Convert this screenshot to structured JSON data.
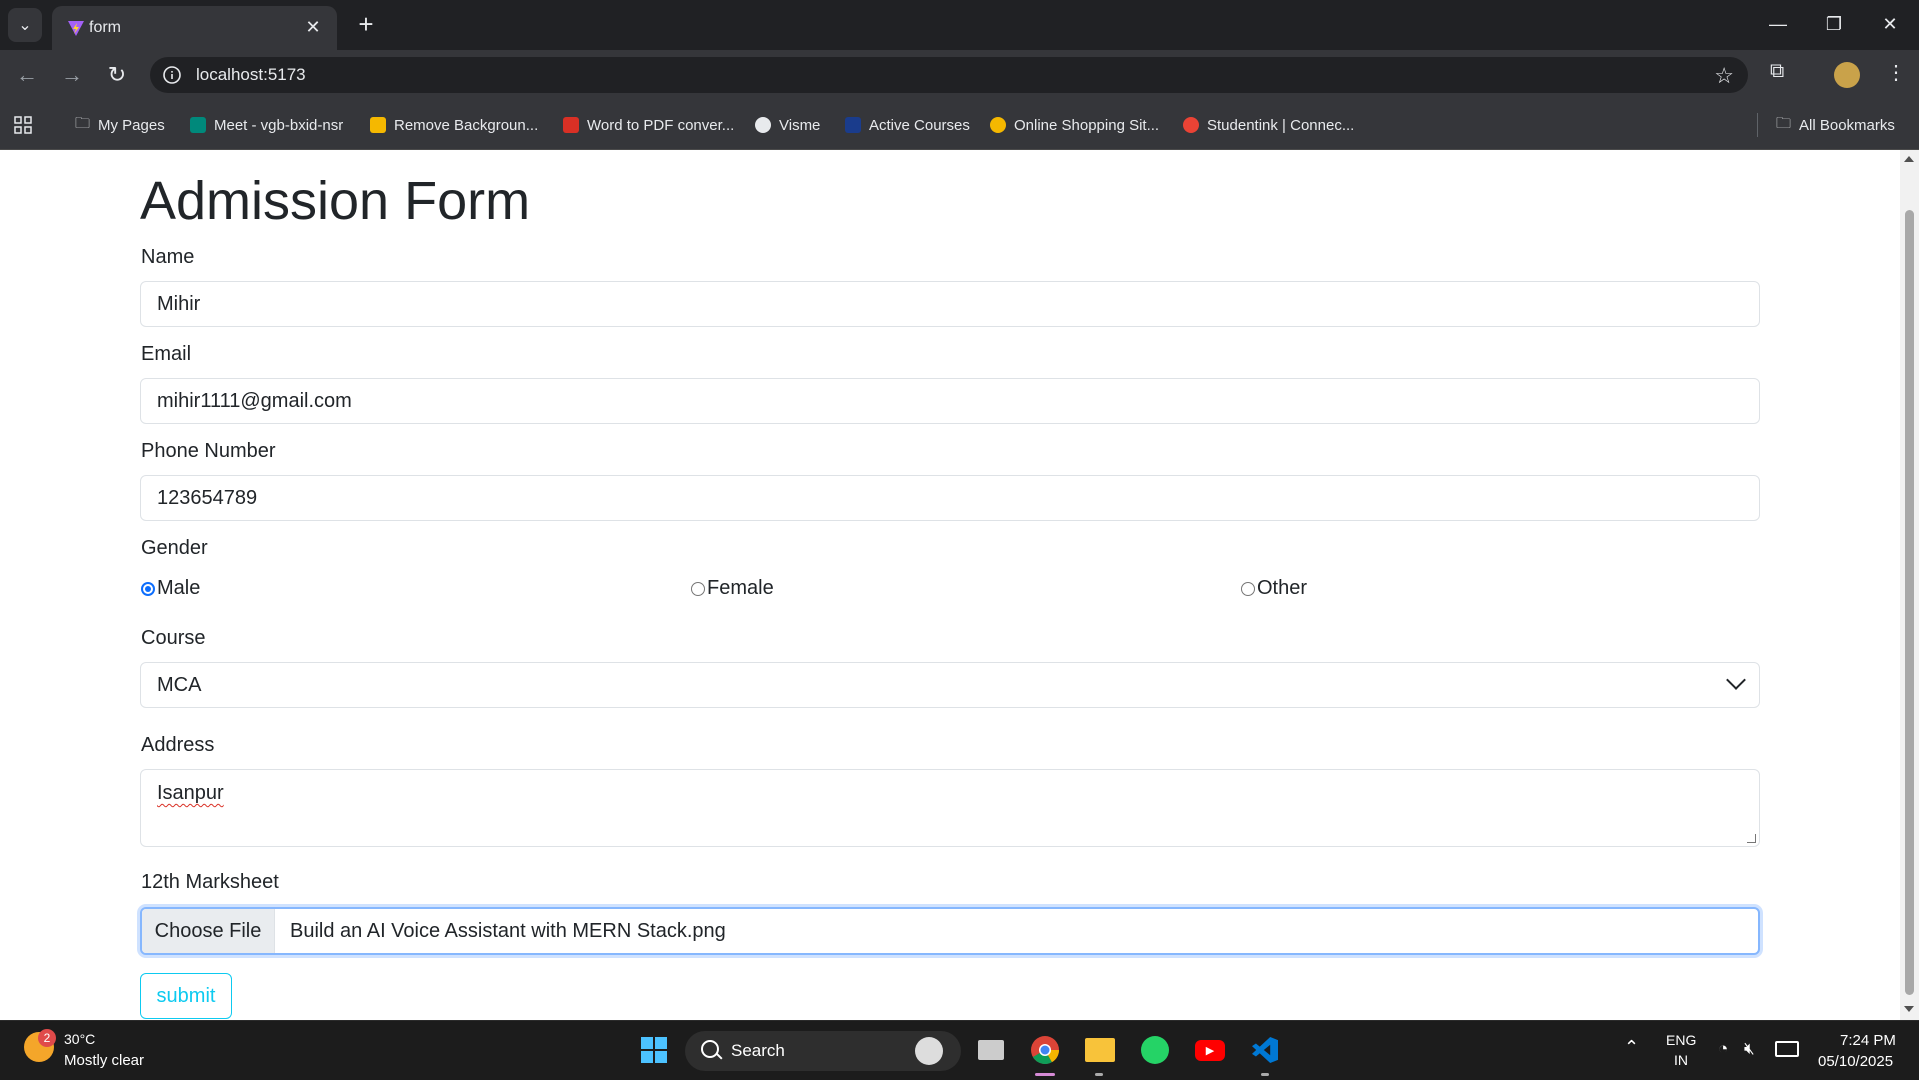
{
  "browser": {
    "tab_title": "form",
    "url": "localhost:5173",
    "bookmarks": [
      "My Pages",
      "Meet - vgb-bxid-nsr",
      "Remove Backgroun...",
      "Word to PDF conver...",
      "Visme",
      "Active Courses",
      "Online Shopping Sit...",
      "Studentink | Connec..."
    ],
    "all_bookmarks": "All Bookmarks"
  },
  "form": {
    "title": "Admission Form",
    "name_label": "Name",
    "name_value": "Mihir",
    "email_label": "Email",
    "email_value": "mihir1111@gmail.com",
    "phone_label": "Phone Number",
    "phone_value": "123654789",
    "gender_label": "Gender",
    "gender_options": [
      "Male",
      "Female",
      "Other"
    ],
    "gender_selected": "Male",
    "course_label": "Course",
    "course_value": "MCA",
    "address_label": "Address",
    "address_value": "Isanpur",
    "marksheet_label": "12th Marksheet",
    "choose_file": "Choose File",
    "file_name": "Build an AI Voice Assistant with MERN Stack.png",
    "submit_label": "submit"
  },
  "taskbar": {
    "weather_badge": "2",
    "temperature": "30°C",
    "condition": "Mostly clear",
    "search_label": "Search",
    "lang_line1": "ENG",
    "lang_line2": "IN",
    "time": "7:24 PM",
    "date": "05/10/2025"
  },
  "colors": {
    "accent": "#0d6efd",
    "submit": "#0dcaf0",
    "chrome_dark": "#202124",
    "chrome_toolbar": "#35363a"
  }
}
